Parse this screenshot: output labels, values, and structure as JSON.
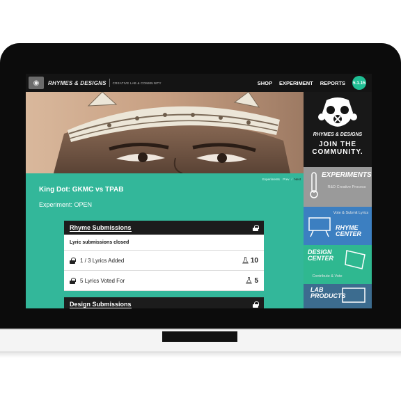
{
  "header": {
    "brand": "RHYMES & DESIGNS",
    "tagline": "CREATIVE LAB & COMMUNITY",
    "nav": [
      "SHOP",
      "EXPERIMENT",
      "REPORTS"
    ],
    "version": "5.1.15"
  },
  "breadcrumbs": {
    "first": "Experiments",
    "prev": "Prev",
    "next": "Next"
  },
  "experiment": {
    "title": "King Dot: GKMC vs TPAB",
    "status": "Experiment: OPEN"
  },
  "rhyme_card": {
    "heading": "Rhyme Submissions",
    "closed": "Lyric submissions closed",
    "rows": [
      {
        "label": "1 / 3 Lyrics Added",
        "value": "10"
      },
      {
        "label": "5 Lyrics Voted For",
        "value": "5"
      }
    ]
  },
  "design_card": {
    "heading": "Design Submissions"
  },
  "sidebar": {
    "brand": "RHYMES & DESIGNS",
    "join": "JOIN THE COMMUNITY.",
    "tiles": [
      {
        "big": "EXPERIMENTS",
        "small": "R&D Creative Process",
        "color": "#9a9a9a"
      },
      {
        "big": "RHYME CENTER",
        "small": "Vote & Submit Lyrics",
        "color": "#3c7fc1"
      },
      {
        "big": "DESIGN CENTER",
        "small": "Contribute & Vote",
        "color": "#2fb890"
      },
      {
        "big": "LAB PRODUCTS",
        "small": "",
        "color": "#3c6c8f"
      }
    ]
  },
  "colors": {
    "accent": "#33b79a",
    "dark": "#141414"
  }
}
